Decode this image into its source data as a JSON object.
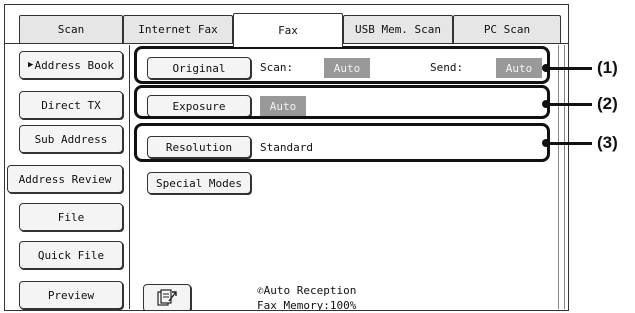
{
  "tabs": [
    {
      "label": "Scan"
    },
    {
      "label": "Internet Fax"
    },
    {
      "label": "Fax"
    },
    {
      "label": "USB Mem. Scan"
    },
    {
      "label": "PC Scan"
    }
  ],
  "nav": {
    "address_book": "Address Book",
    "direct_tx": "Direct TX",
    "sub_address": "Sub Address",
    "address_review": "Address Review",
    "file": "File",
    "quick_file": "Quick File",
    "preview": "Preview"
  },
  "settings": {
    "original_label": "Original",
    "scan_label": "Scan:",
    "scan_value": "Auto",
    "send_label": "Send:",
    "send_value": "Auto",
    "exposure_label": "Exposure",
    "exposure_value": "Auto",
    "resolution_label": "Resolution",
    "resolution_value": "Standard",
    "special_modes_label": "Special Modes"
  },
  "status": {
    "reception": "Auto Reception",
    "memory": "Fax Memory:100%"
  },
  "callouts": [
    "(1)",
    "(2)",
    "(3)"
  ]
}
